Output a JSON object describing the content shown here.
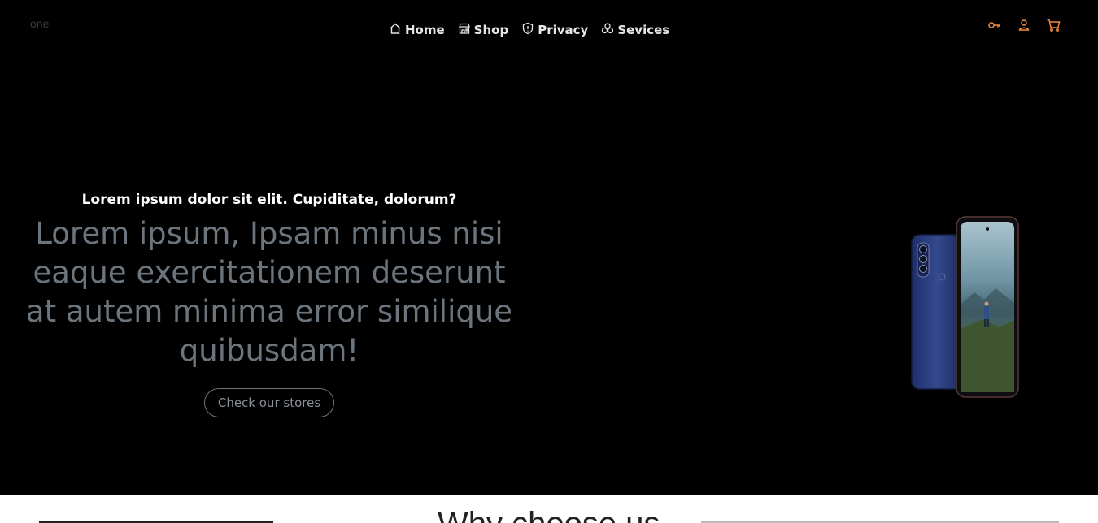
{
  "brand": "one",
  "nav": {
    "items": [
      {
        "label": "Home",
        "icon": "home-icon"
      },
      {
        "label": "Shop",
        "icon": "store-icon"
      },
      {
        "label": "Privacy",
        "icon": "shield-icon"
      },
      {
        "label": "Sevices",
        "icon": "services-icon"
      }
    ]
  },
  "header_icons": [
    "key-icon",
    "user-icon",
    "cart-icon"
  ],
  "hero": {
    "subtitle": "Lorem ipsum dolor sit elit. Cupiditate, dolorum?",
    "headline": "Lorem ipsum, Ipsam minus nisi eaque exercitationem deserunt at autem minima error similique quibusdam!",
    "cta_label": "Check our stores",
    "image": "smartphone-product-image"
  },
  "next_section": {
    "title": "Why choose us"
  },
  "colors": {
    "background": "#000000",
    "accent": "#f08a3c",
    "muted_text": "#6c757d"
  }
}
